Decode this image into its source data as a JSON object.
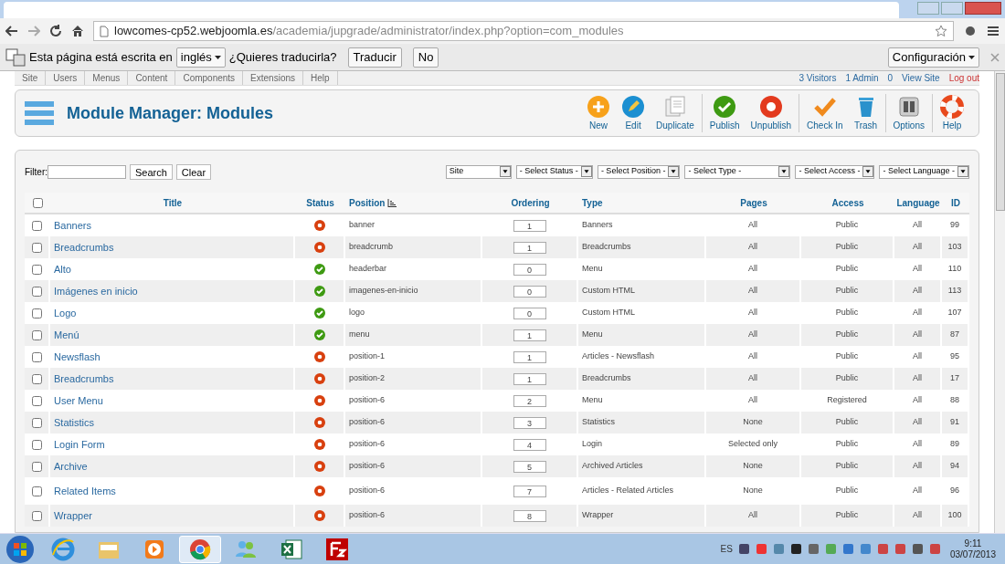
{
  "browser": {
    "url_host": "lowcomes-cp52.webjoomla.es",
    "url_path": "/academia/jupgrade/administrator/index.php?option=com_modules"
  },
  "translate_bar": {
    "message": "Esta página está escrita en",
    "language": "inglés",
    "question": "¿Quieres traducirla?",
    "buttons": [
      "Traducir",
      "No"
    ],
    "settings": "Configuración"
  },
  "admin_menu": {
    "items": [
      "Site",
      "Users",
      "Menus",
      "Content",
      "Components",
      "Extensions",
      "Help"
    ],
    "status": [
      {
        "kind": "visitors",
        "label": "3 Visitors"
      },
      {
        "kind": "admin",
        "label": "1 Admin"
      },
      {
        "kind": "messages",
        "label": "0"
      },
      {
        "kind": "view",
        "label": "View Site"
      },
      {
        "kind": "logout",
        "label": "Log out"
      }
    ]
  },
  "toolbar": {
    "title": "Module Manager: Modules",
    "groups": [
      [
        {
          "kind": "new",
          "label": "New"
        },
        {
          "kind": "edit",
          "label": "Edit"
        },
        {
          "kind": "duplicate",
          "label": "Duplicate"
        }
      ],
      [
        {
          "kind": "publish",
          "label": "Publish"
        },
        {
          "kind": "unpublish",
          "label": "Unpublish"
        }
      ],
      [
        {
          "kind": "checkin",
          "label": "Check In"
        },
        {
          "kind": "trash",
          "label": "Trash"
        }
      ],
      [
        {
          "kind": "options",
          "label": "Options"
        }
      ],
      [
        {
          "kind": "help",
          "label": "Help"
        }
      ]
    ]
  },
  "filter": {
    "label": "Filter:",
    "buttons": [
      "Search",
      "Clear"
    ],
    "selects": [
      "Site",
      "- Select Status -",
      "- Select Position -",
      "- Select Type -",
      "- Select Access -",
      "- Select Language -"
    ]
  },
  "table": {
    "select_all_checked": false,
    "columns": [
      "Title",
      "Status",
      "Position",
      "Ordering",
      "Type",
      "Pages",
      "Access",
      "Language",
      "ID"
    ],
    "rows": [
      {
        "title": "Banners",
        "checked": false,
        "published": false,
        "position": "banner",
        "ordering": "1",
        "type": "Banners",
        "pages": "All",
        "access": "Public",
        "language": "All",
        "id": "99"
      },
      {
        "title": "Breadcrumbs",
        "checked": false,
        "published": false,
        "position": "breadcrumb",
        "ordering": "1",
        "type": "Breadcrumbs",
        "pages": "All",
        "access": "Public",
        "language": "All",
        "id": "103"
      },
      {
        "title": "Alto",
        "checked": false,
        "published": true,
        "position": "headerbar",
        "ordering": "0",
        "type": "Menu",
        "pages": "All",
        "access": "Public",
        "language": "All",
        "id": "110"
      },
      {
        "title": "Imágenes en inicio",
        "checked": false,
        "published": true,
        "position": "imagenes-en-inicio",
        "ordering": "0",
        "type": "Custom HTML",
        "pages": "All",
        "access": "Public",
        "language": "All",
        "id": "113"
      },
      {
        "title": "Logo",
        "checked": false,
        "published": true,
        "position": "logo",
        "ordering": "0",
        "type": "Custom HTML",
        "pages": "All",
        "access": "Public",
        "language": "All",
        "id": "107"
      },
      {
        "title": "Menú",
        "checked": false,
        "published": true,
        "position": "menu",
        "ordering": "1",
        "type": "Menu",
        "pages": "All",
        "access": "Public",
        "language": "All",
        "id": "87"
      },
      {
        "title": "Newsflash",
        "checked": false,
        "published": false,
        "position": "position-1",
        "ordering": "1",
        "type": "Articles - Newsflash",
        "pages": "All",
        "access": "Public",
        "language": "All",
        "id": "95"
      },
      {
        "title": "Breadcrumbs",
        "checked": false,
        "published": false,
        "position": "position-2",
        "ordering": "1",
        "type": "Breadcrumbs",
        "pages": "All",
        "access": "Public",
        "language": "All",
        "id": "17"
      },
      {
        "title": "User Menu",
        "checked": false,
        "published": false,
        "position": "position-6",
        "ordering": "2",
        "type": "Menu",
        "pages": "All",
        "access": "Registered",
        "language": "All",
        "id": "88"
      },
      {
        "title": "Statistics",
        "checked": false,
        "published": false,
        "position": "position-6",
        "ordering": "3",
        "type": "Statistics",
        "pages": "None",
        "access": "Public",
        "language": "All",
        "id": "91"
      },
      {
        "title": "Login Form",
        "checked": false,
        "published": false,
        "position": "position-6",
        "ordering": "4",
        "type": "Login",
        "pages": "Selected only",
        "access": "Public",
        "language": "All",
        "id": "89"
      },
      {
        "title": "Archive",
        "checked": false,
        "published": false,
        "position": "position-6",
        "ordering": "5",
        "type": "Archived Articles",
        "pages": "None",
        "access": "Public",
        "language": "All",
        "id": "94"
      },
      {
        "title": "Related Items",
        "checked": false,
        "published": false,
        "position": "position-6",
        "ordering": "7",
        "type": "Articles - Related Articles",
        "pages": "None",
        "access": "Public",
        "language": "All",
        "id": "96"
      },
      {
        "title": "Wrapper",
        "checked": false,
        "published": false,
        "position": "position-6",
        "ordering": "8",
        "type": "Wrapper",
        "pages": "All",
        "access": "Public",
        "language": "All",
        "id": "100"
      }
    ]
  },
  "taskbar": {
    "apps": [
      {
        "kind": "ie",
        "selected": false
      },
      {
        "kind": "folder",
        "selected": false
      },
      {
        "kind": "media",
        "selected": false
      },
      {
        "kind": "chrome",
        "selected": true
      },
      {
        "kind": "messenger",
        "selected": false
      },
      {
        "kind": "excel",
        "selected": false
      },
      {
        "kind": "filezilla",
        "selected": false
      }
    ],
    "language": "ES",
    "time": "9:11",
    "date": "03/07/2013"
  }
}
